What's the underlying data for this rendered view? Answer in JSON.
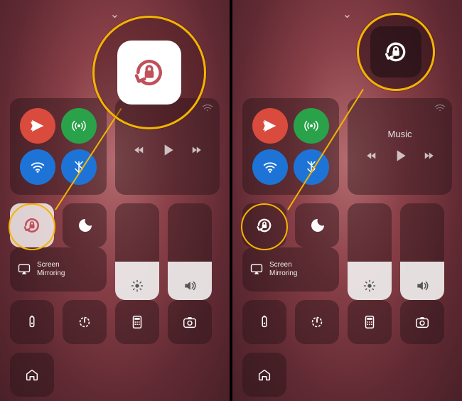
{
  "left": {
    "collapse_caret": "⌄",
    "music": {
      "label": "",
      "controls": {
        "prev": "previous",
        "play": "play",
        "next": "next"
      }
    },
    "connectivity": {
      "airplane": "airplane",
      "cellular": "cellular",
      "wifi": "wifi",
      "bluetooth": "bluetooth"
    },
    "rotation_lock": {
      "state": "on",
      "icon": "rotation-lock-on"
    },
    "dnd": {
      "icon": "do-not-disturb"
    },
    "screen_mirroring": {
      "label": "Screen\nMirroring",
      "icon": "airplay"
    },
    "brightness": {
      "icon": "brightness"
    },
    "volume": {
      "icon": "volume"
    },
    "flashlight": {
      "icon": "flashlight"
    },
    "timer": {
      "icon": "timer"
    },
    "calculator": {
      "icon": "calculator"
    },
    "camera": {
      "icon": "camera"
    },
    "home": {
      "icon": "home"
    },
    "zoom": {
      "target": "rotation-lock-on"
    }
  },
  "right": {
    "collapse_caret": "⌄",
    "music": {
      "label": "Music",
      "controls": {
        "prev": "previous",
        "play": "play",
        "next": "next"
      }
    },
    "connectivity": {
      "airplane": "airplane",
      "cellular": "cellular",
      "wifi": "wifi",
      "bluetooth": "bluetooth"
    },
    "rotation_lock": {
      "state": "off",
      "icon": "rotation-lock-off"
    },
    "dnd": {
      "icon": "do-not-disturb"
    },
    "screen_mirroring": {
      "label": "Screen\nMirroring",
      "icon": "airplay"
    },
    "brightness": {
      "icon": "brightness"
    },
    "volume": {
      "icon": "volume"
    },
    "flashlight": {
      "icon": "flashlight"
    },
    "timer": {
      "icon": "timer"
    },
    "calculator": {
      "icon": "calculator"
    },
    "camera": {
      "icon": "camera"
    },
    "home": {
      "icon": "home"
    },
    "zoom": {
      "target": "rotation-lock-off"
    }
  },
  "colors": {
    "accent": "#f5b301",
    "active_tile": "#ffffffcc",
    "lock_red": "#c0505a"
  }
}
